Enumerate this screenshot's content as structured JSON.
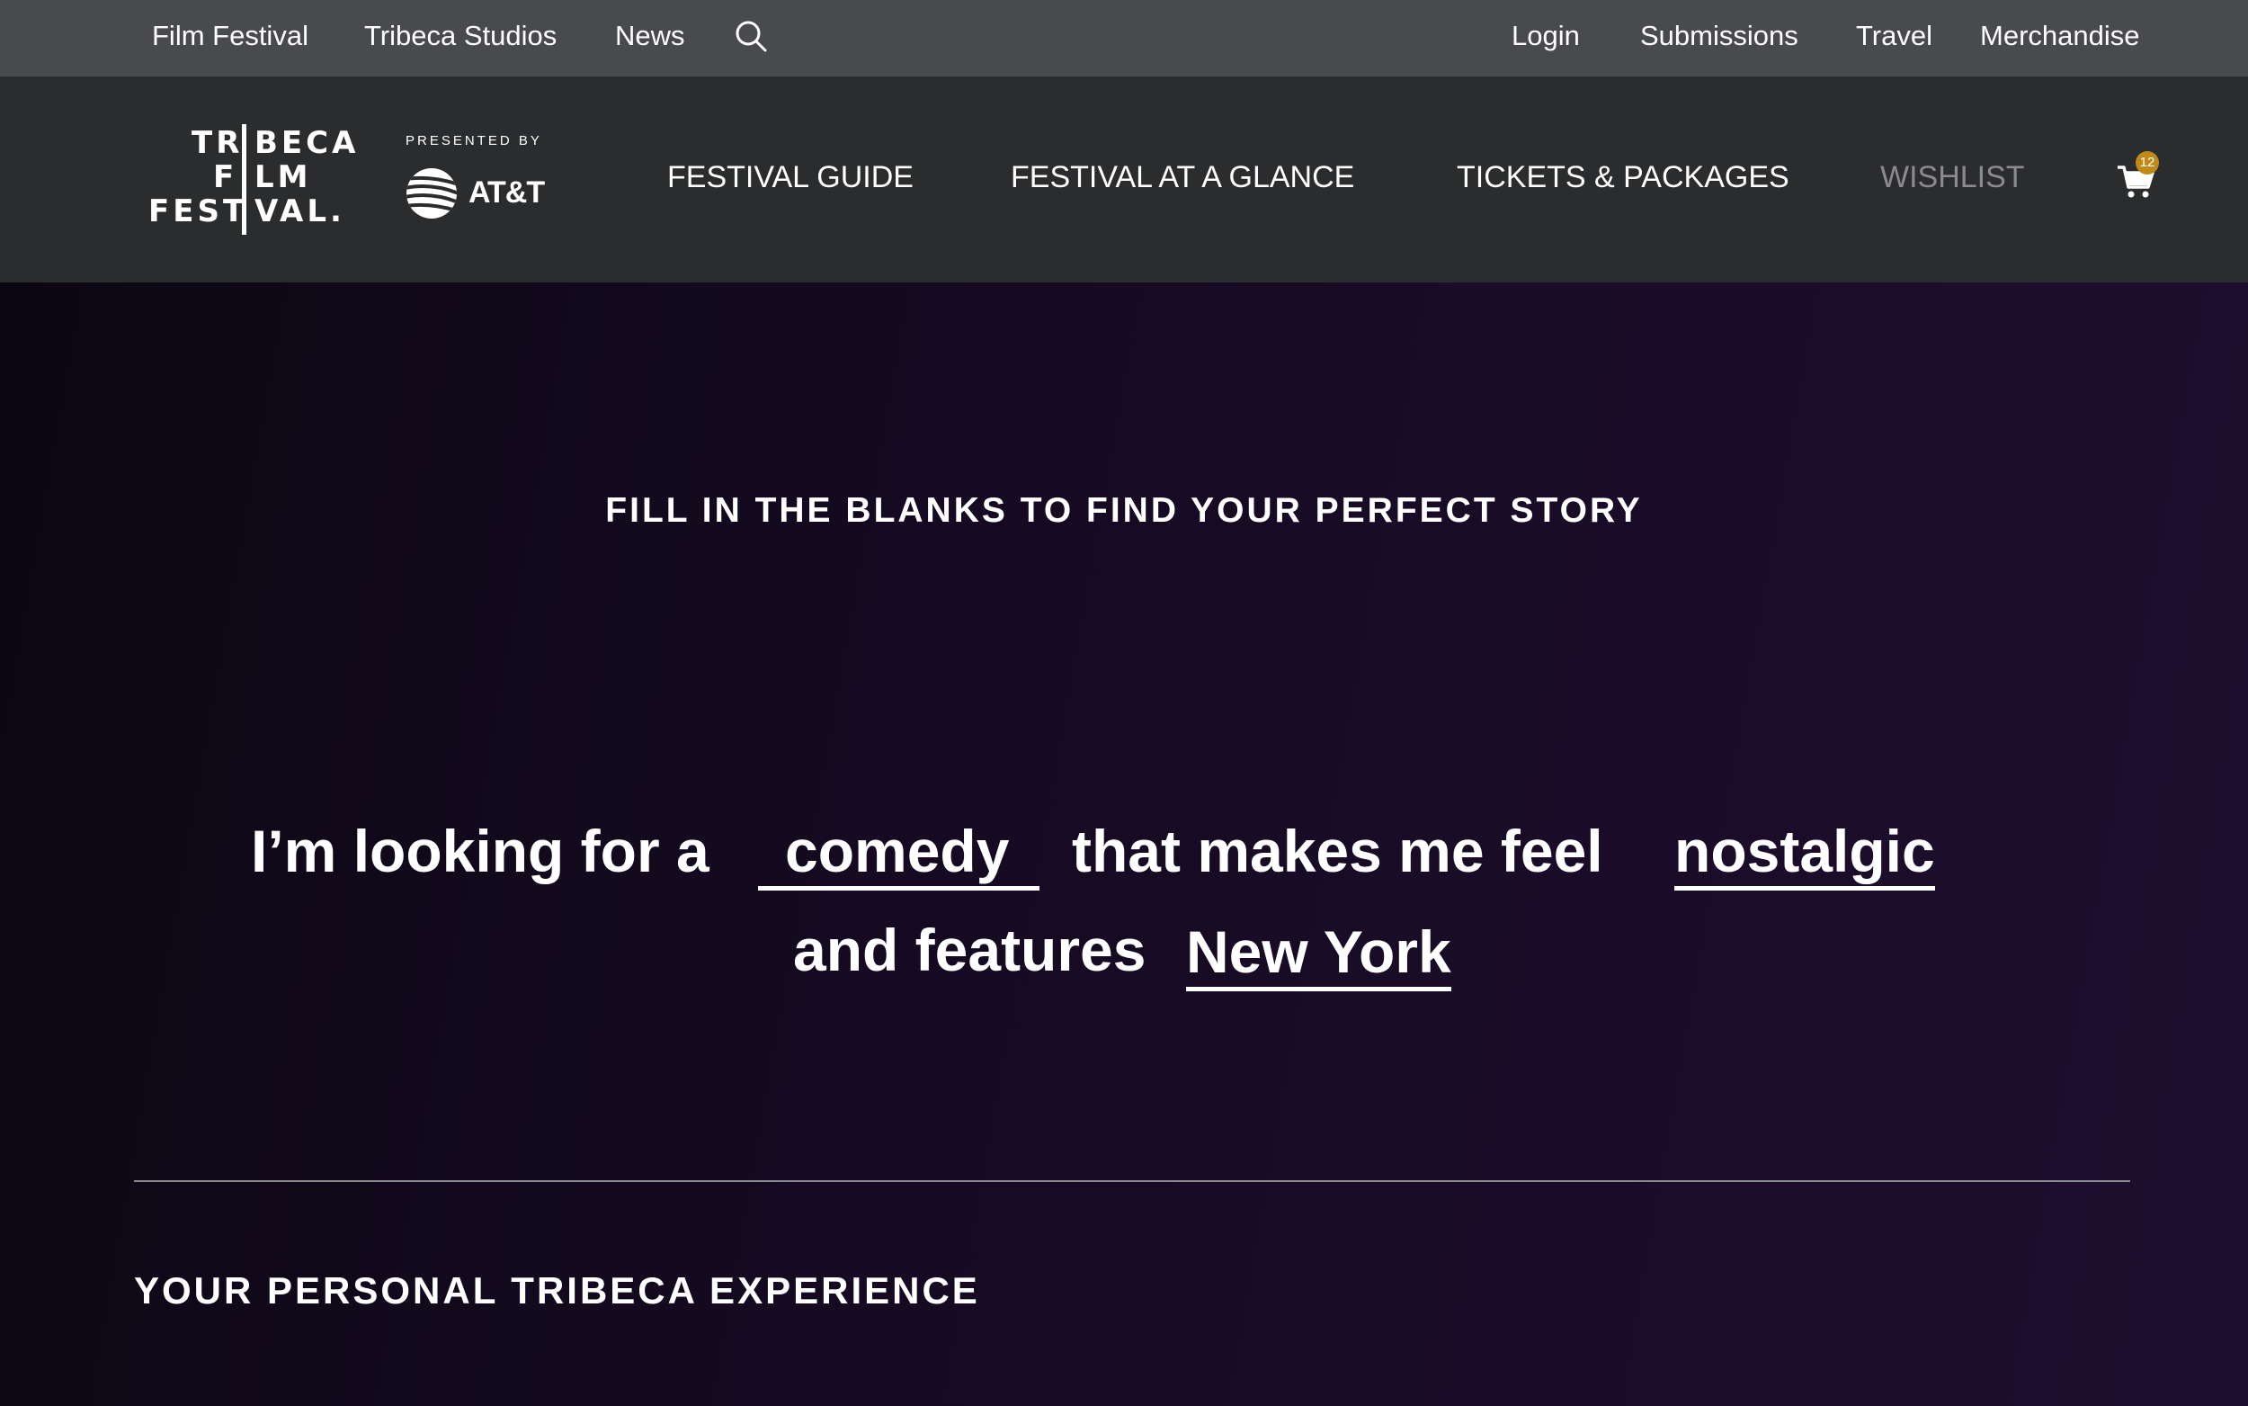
{
  "topbar": {
    "left_links": [
      "Film Festival",
      "Tribeca Studios",
      "News"
    ],
    "right_links": [
      "Login",
      "Submissions",
      "Travel",
      "Merchandise"
    ],
    "search_icon": "search-icon"
  },
  "header": {
    "logo_lines": [
      "TR",
      "BECA",
      "F",
      "LM",
      "FEST",
      "VAL."
    ],
    "presented_by": "PRESENTED BY",
    "sponsor": "AT&T",
    "nav": [
      "FESTIVAL GUIDE",
      "FESTIVAL AT A GLANCE",
      "TICKETS & PACKAGES",
      "WISHLIST"
    ],
    "cart_count": "12",
    "cart_icon": "cart-icon"
  },
  "hero": {
    "kicker": "FILL IN THE BLANKS TO FIND YOUR PERFECT STORY",
    "sentence_part1": "I’m looking for a",
    "genre": "comedy",
    "sentence_part2": "that makes me feel",
    "mood": "nostalgic",
    "sentence_part3": "and features",
    "place": "New York"
  },
  "section": {
    "title": "YOUR PERSONAL TRIBECA EXPERIENCE"
  },
  "colors": {
    "topbar": "#484a4d",
    "mainnav": "#2a2c2d",
    "hero_bg": "#150b20",
    "badge": "#c08a1a",
    "dim_nav": "#8b8b8d"
  }
}
